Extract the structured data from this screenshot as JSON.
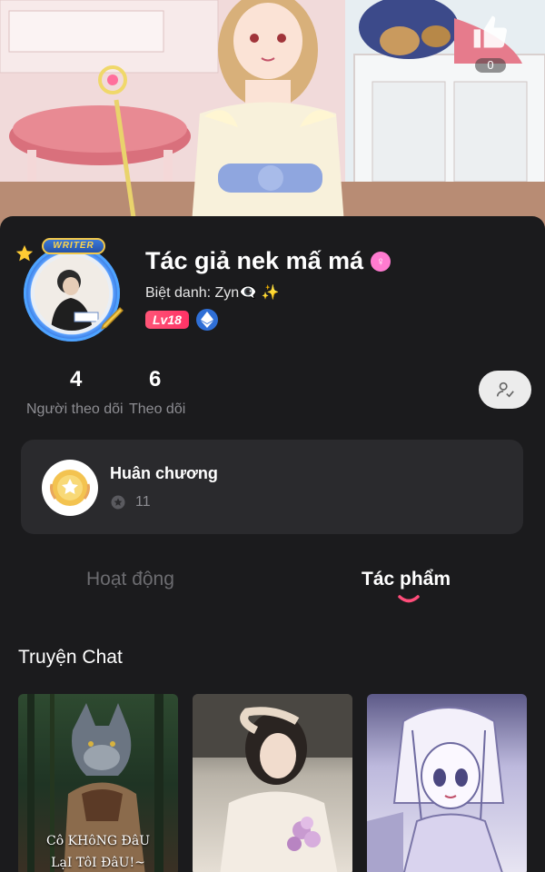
{
  "banner": {
    "like_count": "0"
  },
  "profile": {
    "writer_tag": "WRITER",
    "name": "Tác giả nek mấ má",
    "gender_symbol": "♀",
    "nickname": "Biệt danh: Zyn👁‍🗨 ✨",
    "level": "Lv18"
  },
  "stats": {
    "followers_count": "4",
    "followers_label": "Người theo dõi",
    "following_count": "6",
    "following_label": "Theo dõi"
  },
  "medal": {
    "title": "Huân chương",
    "count": "11"
  },
  "tabs": {
    "activity": "Hoạt động",
    "works": "Tác phẩm",
    "active": "works"
  },
  "section": {
    "title": "Truyện Chat"
  },
  "stories": [
    {
      "caption_line1": "Cô KHôNG ĐâU",
      "caption_line2": "LạI TôI ĐâU!~"
    },
    {
      "caption_line1": "",
      "caption_line2": ""
    },
    {
      "caption_line1": "",
      "caption_line2": ""
    }
  ],
  "colors": {
    "accent": "#ff4d7a",
    "background": "#1b1b1d",
    "card": "#2a2a2d"
  }
}
